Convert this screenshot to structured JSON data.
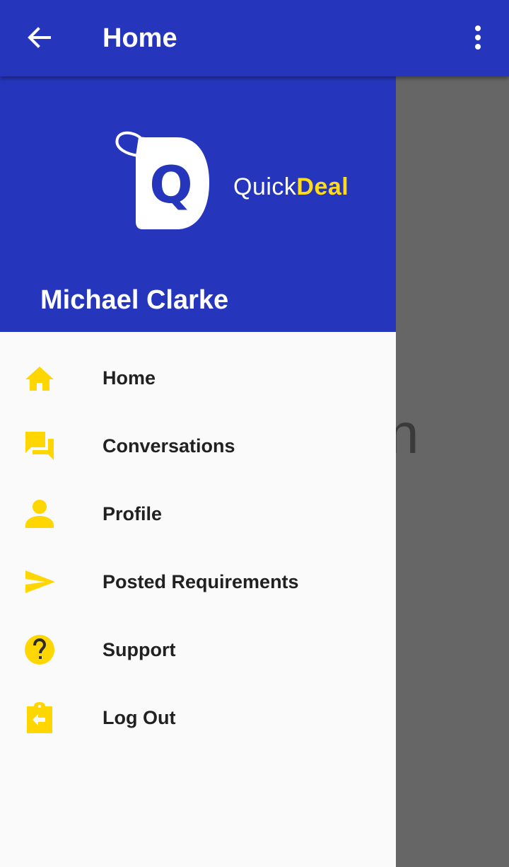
{
  "appbar": {
    "title": "Home",
    "back_icon": "arrow-back-icon",
    "more_icon": "more-vert-icon"
  },
  "background": {
    "partial_text": "n"
  },
  "drawer": {
    "brand": {
      "logo_letter": "Q",
      "name_light": "Quick",
      "name_bold": "Deal"
    },
    "user_name": "Michael Clarke",
    "items": [
      {
        "label": "Home",
        "icon": "home-icon"
      },
      {
        "label": "Conversations",
        "icon": "forum-icon"
      },
      {
        "label": "Profile",
        "icon": "person-icon"
      },
      {
        "label": "Posted Requirements",
        "icon": "send-icon"
      },
      {
        "label": "Support",
        "icon": "help-icon"
      },
      {
        "label": "Log Out",
        "icon": "logout-clipboard-icon"
      }
    ]
  },
  "colors": {
    "primary": "#2536bd",
    "accent": "#ffd600",
    "scrim": "#666666",
    "drawer_bg": "#fafafa"
  }
}
